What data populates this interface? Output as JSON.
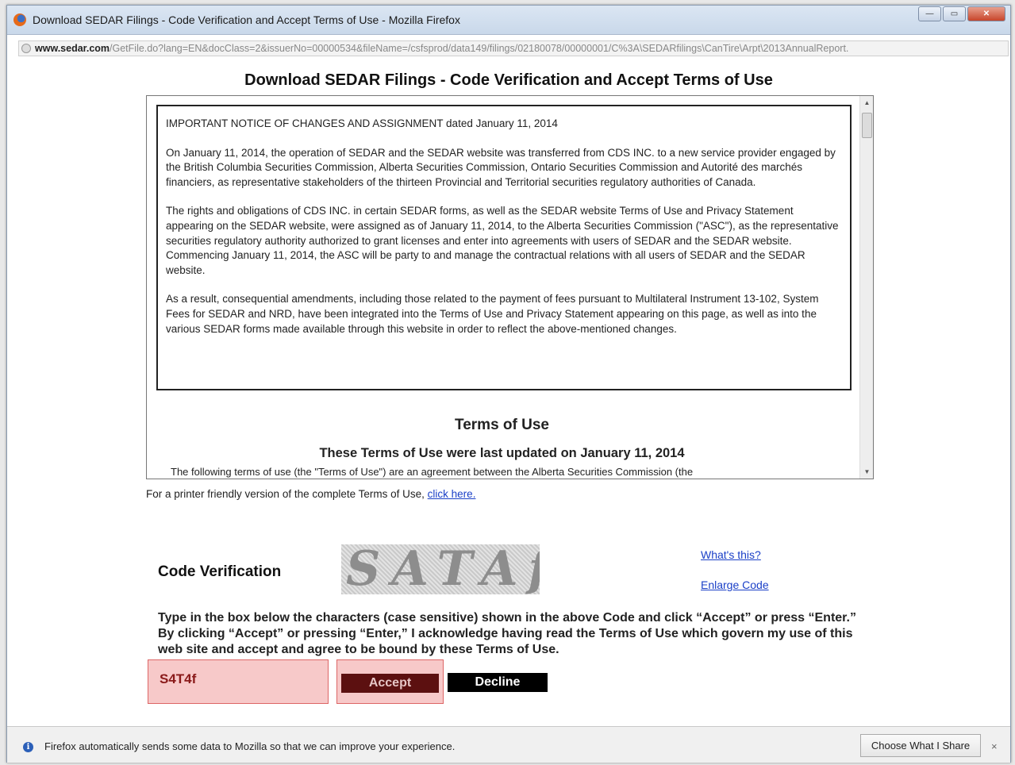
{
  "window": {
    "title": "Download SEDAR Filings - Code Verification and Accept Terms of Use - Mozilla Firefox",
    "controls": {
      "minimize": "—",
      "maximize": "▭",
      "close": "✕"
    }
  },
  "urlbar": {
    "host": "www.sedar.com",
    "path": "/GetFile.do?lang=EN&docClass=2&issuerNo=00000534&fileName=/csfsprod/data149/filings/02180078/00000001/C%3A\\SEDARfilings\\CanTire\\Arpt\\2013AnnualReport."
  },
  "page": {
    "title": "Download SEDAR Filings - Code Verification and Accept Terms of Use",
    "notice": {
      "heading": "IMPORTANT NOTICE OF CHANGES AND ASSIGNMENT dated January 11, 2014",
      "p1": "On January 11, 2014, the operation of SEDAR and the SEDAR website was transferred from CDS INC. to a new service provider engaged by the British Columbia Securities Commission, Alberta Securities Commission, Ontario Securities Commission and Autorité des marchés financiers, as representative stakeholders of the thirteen Provincial and Territorial securities regulatory authorities of Canada.",
      "p2": "The rights and obligations of CDS INC. in certain SEDAR forms, as well as the SEDAR website Terms of Use and Privacy Statement appearing on the SEDAR website, were assigned as of January 11, 2014, to the Alberta Securities Commission (\"ASC\"), as the representative securities regulatory authority authorized to grant licenses and enter into agreements with users of SEDAR and the SEDAR website. Commencing January 11, 2014, the ASC will be party to and manage the contractual relations with all users of SEDAR and the SEDAR website.",
      "p3": "As a result, consequential amendments, including those related to the payment of fees pursuant to Multilateral Instrument 13-102, System Fees for SEDAR and NRD, have been integrated into the Terms of Use and Privacy Statement appearing on this page, as well as into the various SEDAR forms made available through this website in order to reflect the above-mentioned changes."
    },
    "terms_title": "Terms of Use",
    "terms_updated": "These Terms of Use were last updated on January 11, 2014",
    "terms_cutoff": "The following terms of use (the \"Terms of Use\") are an agreement between the Alberta Securities Commission (the",
    "printer_text": "For a printer friendly version of the complete Terms of Use,",
    "printer_link": "click here."
  },
  "verification": {
    "label": "Code Verification",
    "captcha_text": "SATAf",
    "whats_this": "What's this?",
    "enlarge_code": "Enlarge Code",
    "instructions": "Type in the box below the characters (case sensitive) shown in the above Code and click “Accept” or press “Enter.” By clicking “Accept” or pressing “Enter,” I acknowledge having read the Terms of Use which govern my use of this web site and accept and agree to be bound by these Terms of Use.",
    "code_value": "S4T4f",
    "accept_label": "Accept",
    "decline_label": "Decline"
  },
  "notification": {
    "text": "Firefox automatically sends some data to Mozilla so that we can improve your experience.",
    "choose_button": "Choose What I Share",
    "close": "×"
  }
}
